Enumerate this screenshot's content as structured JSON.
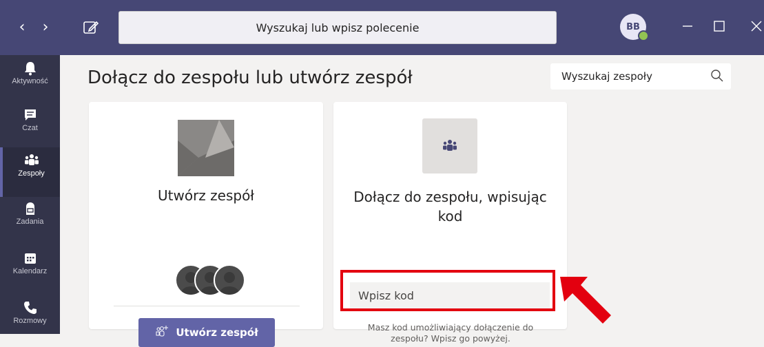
{
  "titlebar": {
    "search_placeholder": "Wyszukaj lub wpisz polecenie",
    "avatar_initials": "BB",
    "accent": "#464775"
  },
  "rail": {
    "items": [
      {
        "label": "Aktywność",
        "icon": "bell-icon"
      },
      {
        "label": "Czat",
        "icon": "chat-icon"
      },
      {
        "label": "Zespoły",
        "icon": "teams-icon",
        "active": true
      },
      {
        "label": "Zadania",
        "icon": "backpack-icon"
      },
      {
        "label": "Kalendarz",
        "icon": "calendar-icon"
      },
      {
        "label": "Rozmowy",
        "icon": "phone-icon"
      }
    ]
  },
  "main": {
    "title": "Dołącz do zespołu lub utwórz zespół",
    "search_placeholder": "Wyszukaj zespoły",
    "create_card": {
      "title": "Utwórz zespół",
      "button_label": "Utwórz zespół"
    },
    "join_card": {
      "title_line1": "Dołącz do zespołu, wpisując",
      "title_line2": "kod",
      "input_placeholder": "Wpisz kod",
      "hint_line1": "Masz kod umożliwiający dołączenie do",
      "hint_line2": "zespołu? Wpisz go powyżej."
    }
  },
  "annotation": {
    "highlight_color": "#e3000f"
  }
}
